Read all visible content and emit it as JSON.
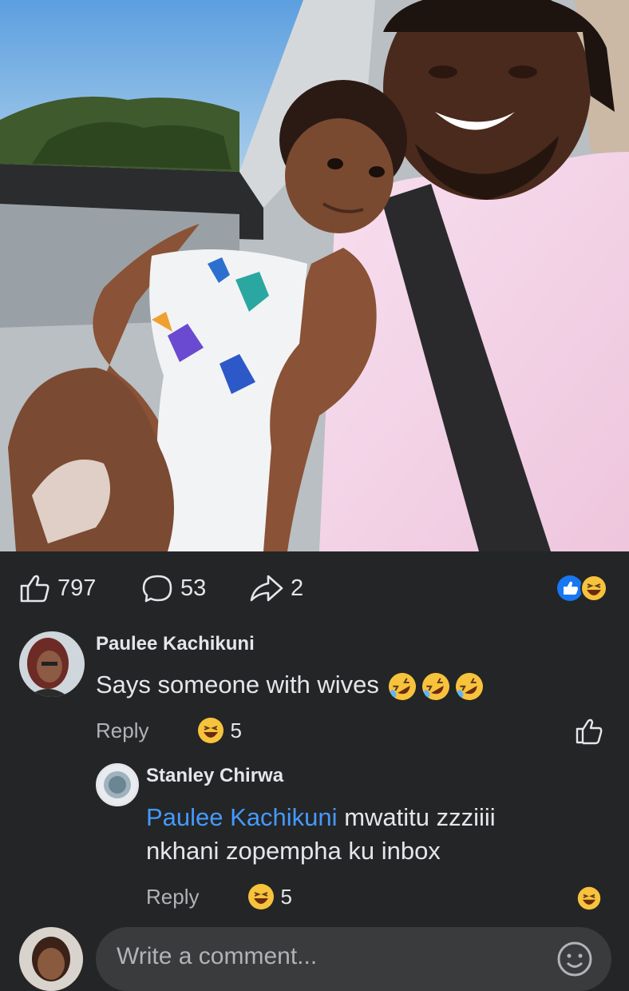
{
  "post": {
    "stats": {
      "likes": "797",
      "comments": "53",
      "shares": "2"
    },
    "reaction_icons": [
      "like-reaction-icon",
      "haha-reaction-icon"
    ]
  },
  "comments": [
    {
      "author": "Paulee  Kachikuni",
      "text": "Says someone with wives",
      "trailing_emoji": [
        "rofl",
        "rofl",
        "rofl"
      ],
      "reply_label": "Reply",
      "reaction_count": "5",
      "reaction_icon": "haha-emoji-icon",
      "replies": [
        {
          "author": "Stanley Chirwa",
          "mention": "Paulee  Kachikuni",
          "text_line1": "mwatitu zzziiii",
          "text_line2": "nkhani zopempha ku inbox",
          "reply_label": "Reply",
          "reaction_count": "5",
          "reaction_icon": "haha-emoji-icon"
        }
      ]
    }
  ],
  "composer": {
    "placeholder": "Write a comment..."
  },
  "colors": {
    "background": "#242526",
    "text": "#e4e6eb",
    "secondary_text": "#b0b3b8",
    "mention": "#4599ff",
    "like_blue": "#1877f2",
    "emoji_yellow": "#f7c33c"
  }
}
